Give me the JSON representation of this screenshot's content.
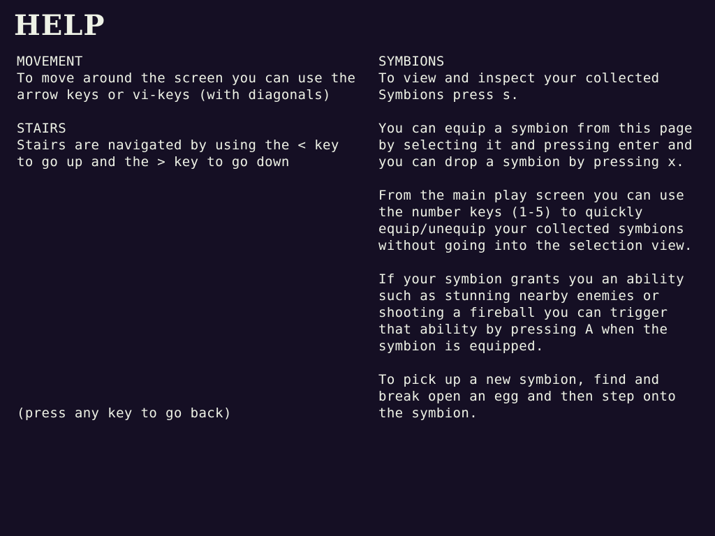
{
  "title": "HELP",
  "left_column": {
    "movement": {
      "heading": "MOVEMENT",
      "lines": [
        "To move around the screen you can use the",
        "arrow keys or vi-keys (with diagonals)"
      ]
    },
    "stairs": {
      "heading": "STAIRS",
      "lines": [
        "Stairs are navigated by using the < key",
        "to go up and the > key to go down"
      ]
    }
  },
  "right_column": {
    "symbions": {
      "heading": "SYMBIONS",
      "lines": [
        "To view and inspect your collected",
        "Symbions press s."
      ]
    },
    "equip": {
      "lines": [
        "You can equip a symbion from this page",
        "by selecting it and pressing enter and",
        "you can drop a symbion by pressing x."
      ]
    },
    "quick_equip": {
      "lines": [
        "From the main play screen you can use",
        "the number keys (1-5) to quickly",
        "equip/unequip your collected symbions",
        "without going into the selection view."
      ]
    },
    "ability": {
      "lines": [
        "If your symbion grants you an ability",
        "such as stunning nearby enemies or",
        "shooting a fireball you can trigger",
        "that ability by pressing A when the",
        "symbion is equipped."
      ]
    },
    "pickup": {
      "lines": [
        "To pick up a new symbion, find and",
        "break open an egg and then step onto",
        "the symbion."
      ]
    }
  },
  "back_hint": "(press any key to go back)",
  "colors": {
    "background": "#150f24",
    "text": "#eef2e6"
  }
}
